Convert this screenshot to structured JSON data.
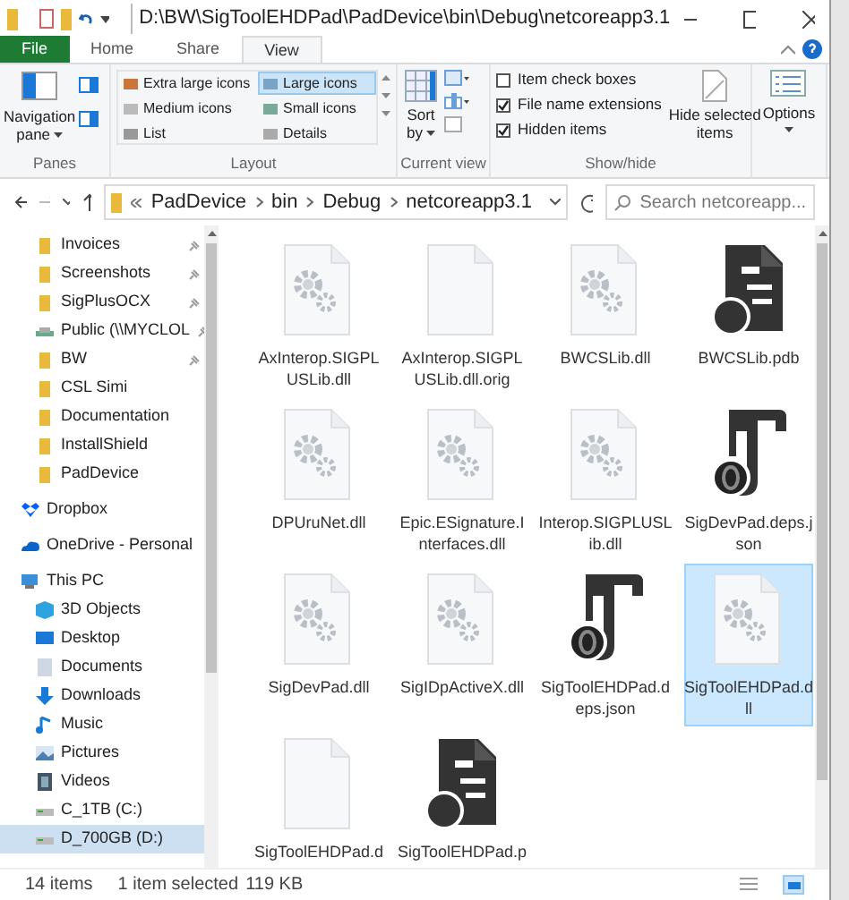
{
  "window": {
    "title": "D:\\BW\\SigToolEHDPad\\PadDevice\\bin\\Debug\\netcoreapp3.1"
  },
  "tabs": [
    {
      "label": "File",
      "kind": "file",
      "selected": false
    },
    {
      "label": "Home",
      "kind": "tab",
      "selected": false
    },
    {
      "label": "Share",
      "kind": "tab",
      "selected": false
    },
    {
      "label": "View",
      "kind": "tab",
      "selected": true
    }
  ],
  "ribbon": {
    "panes": {
      "navigation_pane": "Navigation",
      "navigation_pane_2": "pane",
      "label": "Panes"
    },
    "layout": {
      "options": [
        {
          "label": "Extra large icons",
          "selected": false
        },
        {
          "label": "Large icons",
          "selected": true
        },
        {
          "label": "Medium icons",
          "selected": false
        },
        {
          "label": "Small icons",
          "selected": false
        },
        {
          "label": "List",
          "selected": false
        },
        {
          "label": "Details",
          "selected": false
        }
      ],
      "label": "Layout"
    },
    "current_view": {
      "sort_by": "Sort",
      "sort_by_2": "by",
      "label": "Current view"
    },
    "show_hide": {
      "checkboxes": [
        {
          "label": "Item check boxes",
          "checked": false
        },
        {
          "label": "File name extensions",
          "checked": true
        },
        {
          "label": "Hidden items",
          "checked": true
        }
      ],
      "hide_selected": "Hide selected",
      "hide_selected_2": "items",
      "label": "Show/hide"
    },
    "options": "Options"
  },
  "address_bar": {
    "crumbs": [
      "PadDevice",
      "bin",
      "Debug",
      "netcoreapp3.1"
    ],
    "search_placeholder": "Search netcoreapp..."
  },
  "sidebar": {
    "items": [
      {
        "label": "Invoices",
        "kind": "folder",
        "pinned": true,
        "selected": false
      },
      {
        "label": "Screenshots",
        "kind": "folder",
        "pinned": true,
        "selected": false
      },
      {
        "label": "SigPlusOCX",
        "kind": "folder",
        "pinned": true,
        "selected": false
      },
      {
        "label": "Public (\\\\MYCLOL",
        "kind": "network",
        "pinned": true,
        "selected": false
      },
      {
        "label": "BW",
        "kind": "folder",
        "pinned": true,
        "selected": false
      },
      {
        "label": "CSL Simi",
        "kind": "folder",
        "pinned": false,
        "selected": false
      },
      {
        "label": "Documentation",
        "kind": "folder",
        "pinned": false,
        "selected": false
      },
      {
        "label": "InstallShield",
        "kind": "folder",
        "pinned": false,
        "selected": false
      },
      {
        "label": "PadDevice",
        "kind": "folder",
        "pinned": false,
        "selected": false
      },
      {
        "label": "Dropbox",
        "kind": "dropbox",
        "pinned": false,
        "selected": false
      },
      {
        "label": "OneDrive - Personal",
        "kind": "onedrive",
        "pinned": false,
        "selected": false
      },
      {
        "label": "This PC",
        "kind": "pc",
        "pinned": false,
        "selected": false
      },
      {
        "label": "3D Objects",
        "kind": "cube",
        "pinned": false,
        "selected": false
      },
      {
        "label": "Desktop",
        "kind": "desktop",
        "pinned": false,
        "selected": false
      },
      {
        "label": "Documents",
        "kind": "documents",
        "pinned": false,
        "selected": false
      },
      {
        "label": "Downloads",
        "kind": "downloads",
        "pinned": false,
        "selected": false
      },
      {
        "label": "Music",
        "kind": "music",
        "pinned": false,
        "selected": false
      },
      {
        "label": "Pictures",
        "kind": "pictures",
        "pinned": false,
        "selected": false
      },
      {
        "label": "Videos",
        "kind": "videos",
        "pinned": false,
        "selected": false
      },
      {
        "label": "C_1TB (C:)",
        "kind": "drive",
        "pinned": false,
        "selected": false
      },
      {
        "label": "D_700GB (D:)",
        "kind": "drive",
        "pinned": false,
        "selected": true
      }
    ]
  },
  "files": [
    {
      "lines": [
        "AxInterop.SIGPL",
        "USLib.dll"
      ],
      "kind": "dll",
      "selected": false
    },
    {
      "lines": [
        "AxInterop.SIGPL",
        "USLib.dll.orig"
      ],
      "kind": "blank",
      "selected": false
    },
    {
      "lines": [
        "BWCSLib.dll"
      ],
      "kind": "dll",
      "selected": false
    },
    {
      "lines": [
        "BWCSLib.pdb"
      ],
      "kind": "pdb",
      "selected": false
    },
    {
      "lines": [
        "DPUruNet.dll"
      ],
      "kind": "dll",
      "selected": false
    },
    {
      "lines": [
        "Epic.ESignature.I",
        "nterfaces.dll"
      ],
      "kind": "dll",
      "selected": false
    },
    {
      "lines": [
        "Interop.SIGPLUSL",
        "ib.dll"
      ],
      "kind": "dll",
      "selected": false
    },
    {
      "lines": [
        "SigDevPad.deps.j",
        "son"
      ],
      "kind": "json",
      "selected": false
    },
    {
      "lines": [
        "SigDevPad.dll"
      ],
      "kind": "dll",
      "selected": false
    },
    {
      "lines": [
        "SigIDpActiveX.dll"
      ],
      "kind": "dll",
      "selected": false
    },
    {
      "lines": [
        "SigToolEHDPad.d",
        "eps.json"
      ],
      "kind": "json",
      "selected": false
    },
    {
      "lines": [
        "SigToolEHDPad.d",
        "ll"
      ],
      "kind": "dll",
      "selected": true
    },
    {
      "lines": [
        "SigToolEHDPad.d"
      ],
      "kind": "blank",
      "selected": false
    },
    {
      "lines": [
        "SigToolEHDPad.p"
      ],
      "kind": "pdb",
      "selected": false
    }
  ],
  "status_bar": {
    "count": "14 items",
    "selection": "1 item selected",
    "size": "119 KB"
  }
}
